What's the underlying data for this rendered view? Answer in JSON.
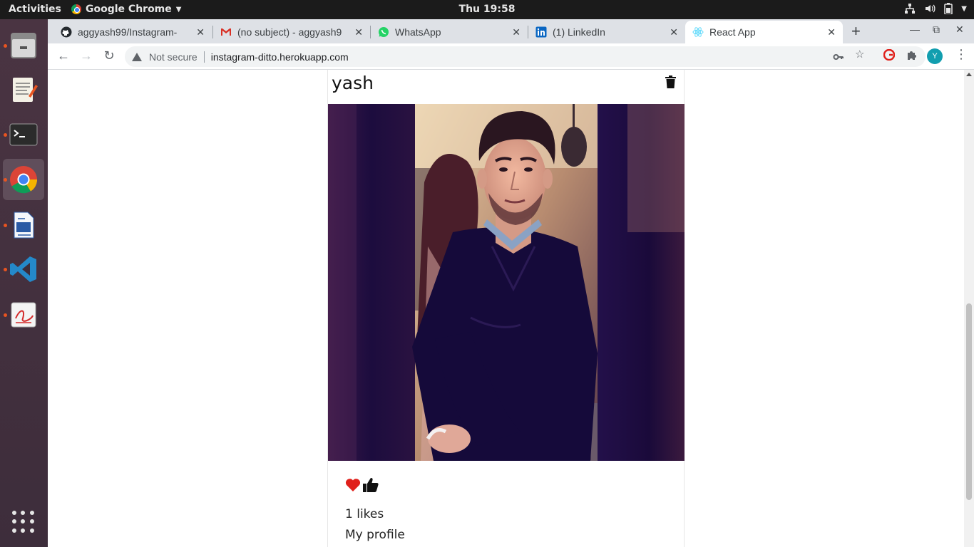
{
  "topbar": {
    "activities": "Activities",
    "app_name": "Google Chrome",
    "clock": "Thu 19:58"
  },
  "dock": {
    "items": [
      "files-icon",
      "text-editor-icon",
      "terminal-icon",
      "chrome-icon",
      "writer-icon",
      "vscode-icon",
      "document-viewer-icon"
    ],
    "show_apps": "show-applications-icon"
  },
  "tabs": [
    {
      "title": "aggyash99/Instagram-",
      "icon": "github-icon"
    },
    {
      "title": "(no subject) - aggyash9",
      "icon": "gmail-icon"
    },
    {
      "title": "WhatsApp",
      "icon": "whatsapp-icon"
    },
    {
      "title": "(1) LinkedIn",
      "icon": "linkedin-icon"
    },
    {
      "title": "React App",
      "icon": "react-icon",
      "active": true
    }
  ],
  "toolbar": {
    "security_label": "Not secure",
    "url": "instagram-ditto.herokuapp.com",
    "profile_initial": "Y"
  },
  "post": {
    "username": "yash",
    "likes_text": "1 likes",
    "caption": "My profile"
  },
  "colors": {
    "heart": "#e0201b",
    "accent_dock_dot": "#e95420",
    "avatar": "#129eaf"
  }
}
